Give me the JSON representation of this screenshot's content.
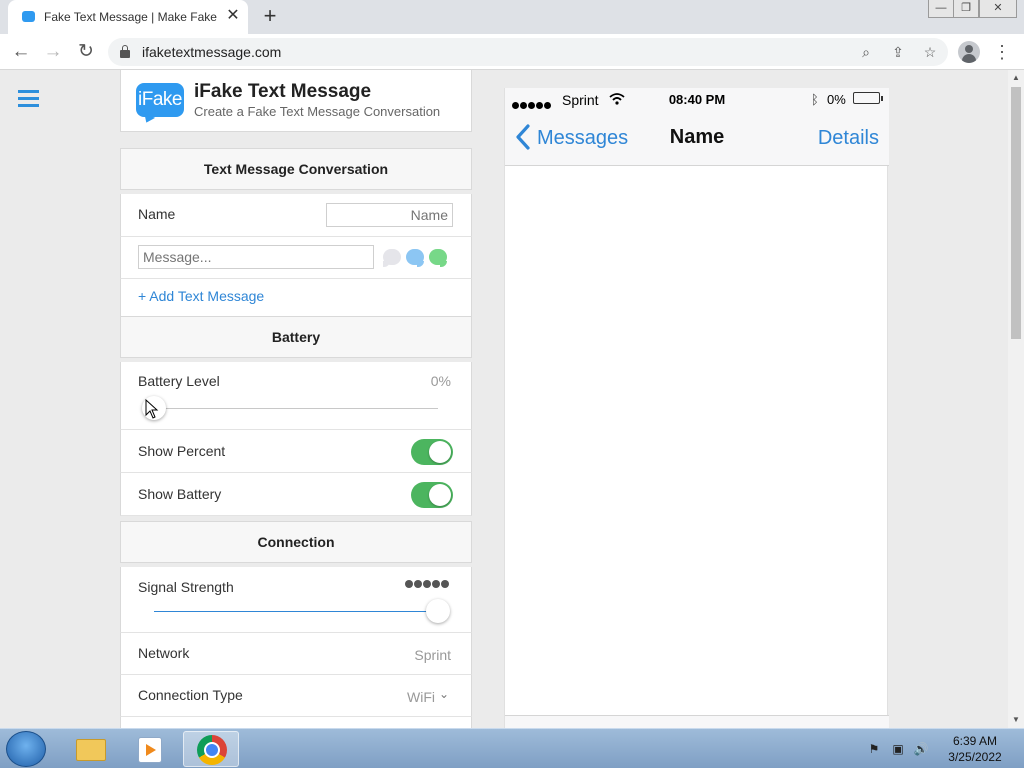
{
  "browser": {
    "tab_title": "Fake Text Message | Make Fake Te",
    "tab_close": "✕",
    "new_tab": "+",
    "url": "ifaketextmessage.com",
    "window_buttons": [
      "—",
      "❐",
      "✕"
    ]
  },
  "sidebar_menu": {
    "icon": "hamburger-icon"
  },
  "brand": {
    "logo_text": "iFake",
    "title": "iFake Text Message",
    "subtitle": "Create a Fake Text Message Conversation"
  },
  "conversation": {
    "heading": "Text Message Conversation",
    "name_label": "Name",
    "name_placeholder": "Name",
    "message_placeholder": "Message...",
    "add_link": "+ Add Text Message"
  },
  "battery": {
    "heading": "Battery",
    "level_label": "Battery Level",
    "level_value": "0%",
    "level_fraction": 0,
    "show_percent_label": "Show Percent",
    "show_percent_on": true,
    "show_battery_label": "Show Battery",
    "show_battery_on": true
  },
  "connection": {
    "heading": "Connection",
    "signal_label": "Signal Strength",
    "signal_bars": 5,
    "signal_fraction": 1,
    "network_label": "Network",
    "network_value": "Sprint",
    "type_label": "Connection Type",
    "type_value": "WiFi"
  },
  "phone": {
    "carrier": "Sprint",
    "time": "08:40 PM",
    "battery_pct": "0%",
    "back_label": "Messages",
    "title": "Name",
    "details_label": "Details"
  },
  "taskbar": {
    "time": "6:39 AM",
    "date": "3/25/2022"
  },
  "colors": {
    "accent_blue": "#2f86d6",
    "toggle_green": "#4cb55f",
    "logo_blue": "#2f9af0"
  }
}
